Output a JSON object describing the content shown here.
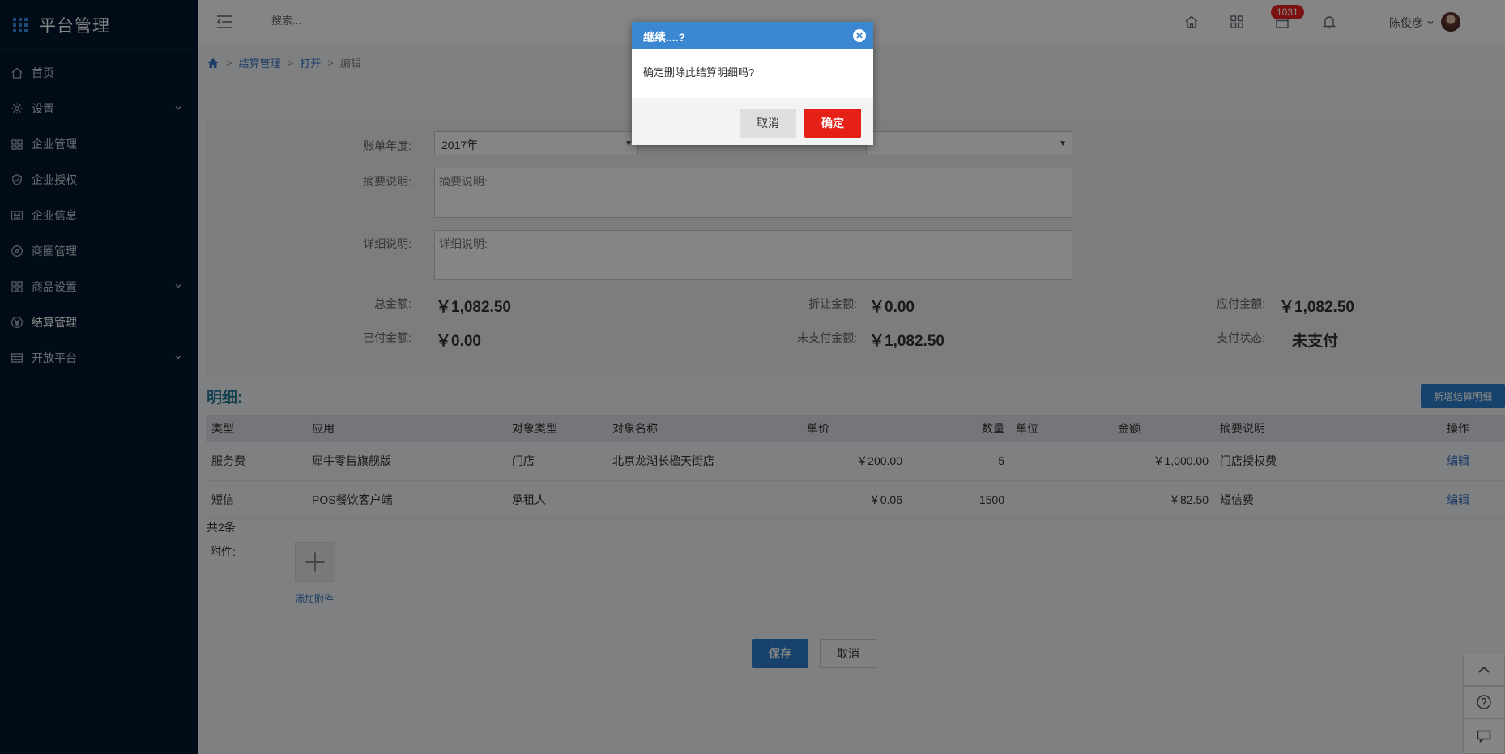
{
  "app": {
    "title": "平台管理"
  },
  "sidebar": {
    "items": [
      {
        "label": "首页",
        "icon": "home-icon"
      },
      {
        "label": "设置",
        "icon": "gear-icon"
      },
      {
        "label": "企业管理",
        "icon": "building-icon"
      },
      {
        "label": "企业授权",
        "icon": "shield-icon"
      },
      {
        "label": "企业信息",
        "icon": "news-icon"
      },
      {
        "label": "商圈管理",
        "icon": "compass-icon"
      },
      {
        "label": "商品设置",
        "icon": "grid-icon"
      },
      {
        "label": "结算管理",
        "icon": "yen-icon"
      },
      {
        "label": "开放平台",
        "icon": "table-icon"
      }
    ]
  },
  "topbar": {
    "search_placeholder": "搜索...",
    "badge_count": "1031",
    "user_name": "陈俊彦"
  },
  "breadcrumb": {
    "items": [
      "结算管理",
      "打开",
      "编辑"
    ]
  },
  "form": {
    "year_label": "账单年度:",
    "year_value": "2017年",
    "summary_label": "摘要说明:",
    "summary_placeholder": "摘要说明:",
    "detail_label": "详细说明:",
    "detail_placeholder": "详细说明:",
    "total_label": "总金额:",
    "total_value": "￥1,082.50",
    "discount_label": "折让金额:",
    "discount_value": "￥0.00",
    "payable_label": "应付金额:",
    "payable_value": "￥1,082.50",
    "paid_label": "已付金额:",
    "paid_value": "￥0.00",
    "unpaid_label": "未支付金额:",
    "unpaid_value": "￥1,082.50",
    "status_label": "支付状态:",
    "status_value": "未支付"
  },
  "details": {
    "title": "明细:",
    "add_button": "新增结算明细",
    "columns": [
      "类型",
      "应用",
      "对象类型",
      "对象名称",
      "单价",
      "数量",
      "单位",
      "金额",
      "摘要说明",
      "操作"
    ],
    "rows": [
      [
        "服务费",
        "犀牛零售旗舰版",
        "门店",
        "北京龙湖长楹天街店",
        "￥200.00",
        "5",
        "",
        "￥1,000.00",
        "门店授权费",
        "编辑"
      ],
      [
        "短信",
        "POS餐饮客户端",
        "承租人",
        "",
        "￥0.06",
        "1500",
        "",
        "￥82.50",
        "短信费",
        "编辑"
      ]
    ],
    "total": "共2条"
  },
  "attachment": {
    "label": "附件:",
    "add_text": "添加附件"
  },
  "actions": {
    "save": "保存",
    "cancel": "取消"
  },
  "dialog": {
    "title": "继续....?",
    "message": "确定删除此结算明细吗?",
    "cancel": "取消",
    "confirm": "确定"
  },
  "colors": {
    "sidebar": "#03172e",
    "primary": "#2b7fd0",
    "danger": "#e52016",
    "dialog_header": "#3b87d2"
  }
}
